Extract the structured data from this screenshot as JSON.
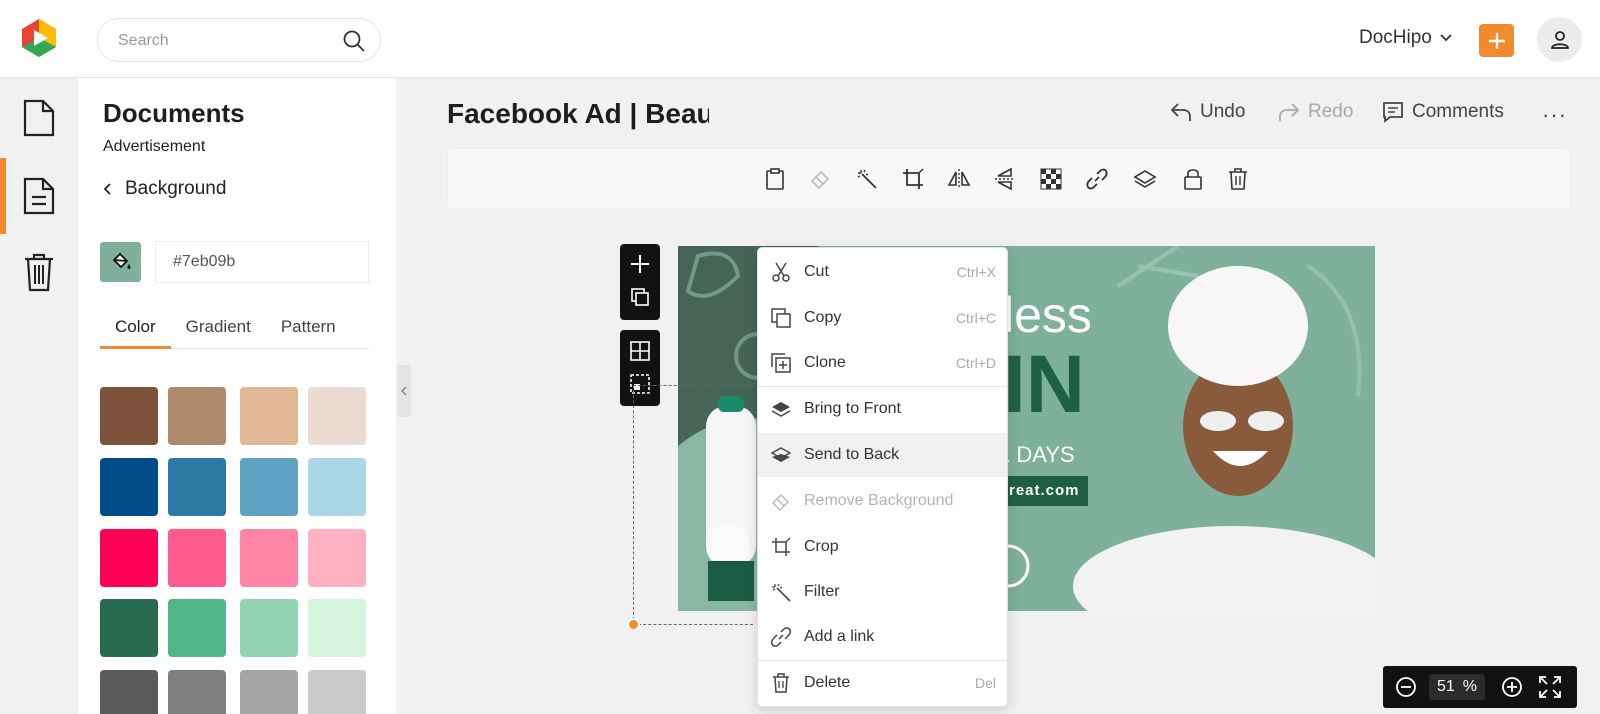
{
  "app": {
    "brand_name": "DocHipo"
  },
  "search": {
    "placeholder": "Search"
  },
  "panel": {
    "title": "Documents",
    "subtitle": "Advertisement",
    "back_label": "Background",
    "color_value": "#7eb09b",
    "tabs": [
      {
        "label": "Color"
      },
      {
        "label": "Gradient"
      },
      {
        "label": "Pattern"
      }
    ],
    "palette": [
      [
        "#7d523a",
        "#b08a6d",
        "#e0b895",
        "#ecdbd0"
      ],
      [
        "#004c87",
        "#2b7aa5",
        "#5ea1c2",
        "#abd6e6"
      ],
      [
        "#ff0056",
        "#ff5a8c",
        "#ff85a6",
        "#ffb0c1"
      ],
      [
        "#296b51",
        "#52b788",
        "#93d4b3",
        "#d6f5de"
      ],
      [
        "#5a5a5a",
        "#808080",
        "#a5a5a5",
        "#cbcbcb"
      ]
    ]
  },
  "document": {
    "title": "Facebook Ad | Beauty Treat"
  },
  "header": {
    "undo_label": "Undo",
    "redo_label": "Redo",
    "comments_label": "Comments"
  },
  "toolbar_icons": [
    "clipboard-icon",
    "eraser-icon",
    "magic-wand-icon",
    "crop-icon",
    "flip-horizontal-icon",
    "flip-vertical-icon",
    "transparency-icon",
    "link-icon",
    "layers-icon",
    "lock-icon",
    "trash-icon"
  ],
  "canvas": {
    "bg_color": "#7eb09b",
    "text_line1": "less",
    "text_line2": "IN",
    "text_line3": "1 DAYS",
    "url_text": "treat.com"
  },
  "context_menu": {
    "items": [
      {
        "label": "Cut",
        "shortcut": "Ctrl+X",
        "icon": "scissors-icon"
      },
      {
        "label": "Copy",
        "shortcut": "Ctrl+C",
        "icon": "copy-icon"
      },
      {
        "label": "Clone",
        "shortcut": "Ctrl+D",
        "icon": "clone-icon"
      },
      {
        "label": "Bring to Front",
        "shortcut": "",
        "icon": "bring-front-icon"
      },
      {
        "label": "Send to Back",
        "shortcut": "",
        "icon": "send-back-icon"
      },
      {
        "label": "Remove Background",
        "shortcut": "",
        "icon": "eraser-icon"
      },
      {
        "label": "Crop",
        "shortcut": "",
        "icon": "crop-icon"
      },
      {
        "label": "Filter",
        "shortcut": "",
        "icon": "magic-wand-icon"
      },
      {
        "label": "Add a link",
        "shortcut": "",
        "icon": "link-icon"
      },
      {
        "label": "Delete",
        "shortcut": "Del",
        "icon": "trash-icon"
      }
    ]
  },
  "zoom": {
    "value": "51",
    "unit": "%"
  },
  "colors": {
    "accent": "#f28a2e",
    "dark": "#111111"
  }
}
